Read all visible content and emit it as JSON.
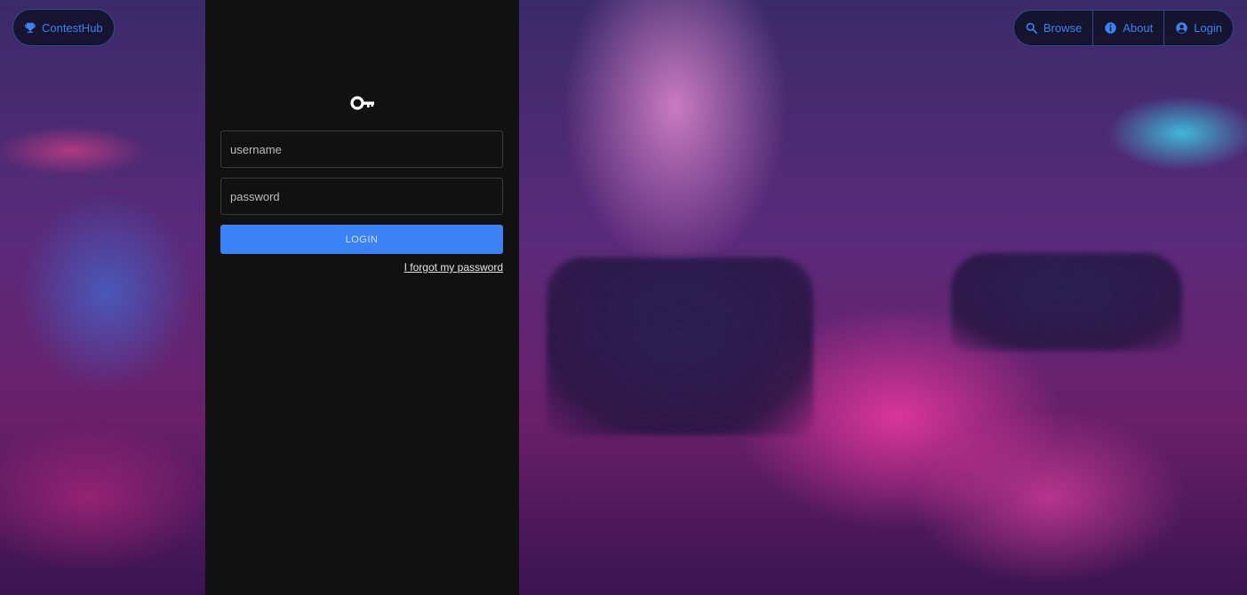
{
  "nav": {
    "brand_label": "ContestHub",
    "items": [
      {
        "label": "Browse",
        "icon": "search-icon"
      },
      {
        "label": "About",
        "icon": "info-icon"
      },
      {
        "label": "Login",
        "icon": "account-circle-icon"
      }
    ]
  },
  "login": {
    "icon": "key-icon",
    "username_placeholder": "username",
    "password_placeholder": "password",
    "submit_label": "LOGIN",
    "forgot_label": "I forgot my password"
  },
  "colors": {
    "accent": "#3b82f6",
    "panel_bg": "#111111"
  }
}
